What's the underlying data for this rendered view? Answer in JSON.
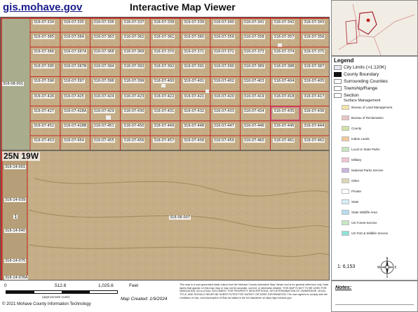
{
  "header": {
    "site": "gis.mohave.gov",
    "title": "Interactive Map Viewer"
  },
  "map": {
    "parcels": [
      [
        "316-07-334",
        "316-07-335",
        "316-07-336",
        "316-07-337",
        "316-07-338",
        "316-07-339",
        "316-07-340",
        "316-07-341",
        "316-07-342",
        "316-07-343"
      ],
      [
        "316-07-365",
        "316-07-364",
        "316-07-363",
        "316-07-362",
        "316-07-361",
        "316-07-360",
        "316-07-359",
        "316-07-358",
        "316-07-357",
        "316-07-356"
      ],
      [
        "316-07-366",
        "316-07-367A",
        "316-07-368",
        "316-07-369",
        "316-07-370",
        "316-07-371",
        "316-07-372",
        "316-07-373",
        "316-07-374",
        "316-07-375"
      ],
      [
        "316-07-395",
        "316-07-367B",
        "316-07-394",
        "316-07-393",
        "316-07-392",
        "316-07-391",
        "316-07-390",
        "316-07-389",
        "316-07-388",
        "316-07-387"
      ],
      [
        "316-07-396",
        "316-07-397",
        "316-07-398",
        "316-07-399",
        "316-07-400",
        "316-07-401",
        "316-07-402",
        "316-07-403",
        "316-07-404",
        "316-07-405"
      ],
      [
        "316-07-426",
        "316-07-425",
        "316-07-424",
        "316-07-423",
        "316-07-422",
        "316-07-421",
        "316-07-420",
        "316-07-419",
        "316-07-418",
        "316-07-417"
      ],
      [
        "316-07-427",
        "316-07-428A",
        "316-07-429",
        "316-07-430",
        "316-07-431",
        "316-07-432",
        "316-07-433",
        "316-07-434",
        "316-07-435",
        "316-07-436"
      ],
      [
        "316-07-452",
        "316-07-428B",
        "316-07-451",
        "316-07-450",
        "316-07-449",
        "316-07-448",
        "316-07-447",
        "316-07-446",
        "316-07-445",
        "316-07-444"
      ],
      [
        "316-07-453",
        "316-07-454",
        "316-07-455",
        "316-07-456",
        "316-07-457",
        "316-07-458",
        "316-07-459",
        "316-07-460",
        "316-07-461",
        "316-07-462"
      ]
    ],
    "west_parcel": "316-08-001",
    "township": "25N 19W",
    "left_strip": [
      "316-14-001",
      "316-14-039",
      "316-14-040",
      "316-14-075",
      "316-14-076A"
    ],
    "big_parcel": "316-06-007",
    "small_mark": "1",
    "highlight_parcel": "316-07-435"
  },
  "legend": {
    "title": "Legend",
    "items": [
      {
        "label": "City Limits (>1:120K)",
        "color": "#e9e6f2"
      },
      {
        "label": "County Boundary",
        "color": "#111111"
      },
      {
        "label": "Surrounding Counties",
        "color": "#ffffff"
      },
      {
        "label": "Township/Range",
        "color": "#ffffff"
      },
      {
        "label": "Section",
        "color": "#ffffff"
      }
    ],
    "surface_title": "Surface Management",
    "surface": [
      {
        "label": "Bureau of Land Management",
        "color": "#f4e4a9"
      },
      {
        "label": "Bureau of Reclamation",
        "color": "#e9c4c4"
      },
      {
        "label": "County",
        "color": "#cfe3a5"
      },
      {
        "label": "Indian Lands",
        "color": "#f2c79a"
      },
      {
        "label": "Local or State Parks",
        "color": "#c8e6bd"
      },
      {
        "label": "Military",
        "color": "#f2c4d8"
      },
      {
        "label": "National Parks Service",
        "color": "#c9b4e0"
      },
      {
        "label": "Other",
        "color": "#ded7b4"
      },
      {
        "label": "Private",
        "color": "#ffffff"
      },
      {
        "label": "State",
        "color": "#d8edf5"
      },
      {
        "label": "State Wildlife Area",
        "color": "#b6ddf1"
      },
      {
        "label": "US Forest Service",
        "color": "#c7e7c3"
      },
      {
        "label": "US Fish & Wildlife Service",
        "color": "#8fe3d6"
      }
    ],
    "scale_ratio": "1: 6,153"
  },
  "footer": {
    "scale_labels": [
      "0",
      "512.8",
      "1,025.6",
      "Feet"
    ],
    "scale_note": "(approximate scale)",
    "copyright": "© 2021 Mohave County Information Technology",
    "map_created": "Map Created: 1/9/2024",
    "disclaimer": "This map is a user generated static output from the Mohave County Interactive Map Viewer and is for general reference only. Data layers that appear on this map may or may not be accurate, current, or otherwise reliable. THIS MAP IS NOT TO BE USED FOR NAVIGATION, AS A LEGAL DOCUMENT, FOR PROPERTY DESCRIPTIONS, OR DETERMINATION OF OWNERSHIP, LEGAL TITLE, AND SHOULD NEVER BE SUBSTITUTED FOR SURVEY OR DEED INFORMATION. The user agrees to comply with the Limitation of Use, and Assumption of Risk as stated in the full disclaimer at https://gis.mohave.gov.",
    "notes_title": "Notes:"
  }
}
